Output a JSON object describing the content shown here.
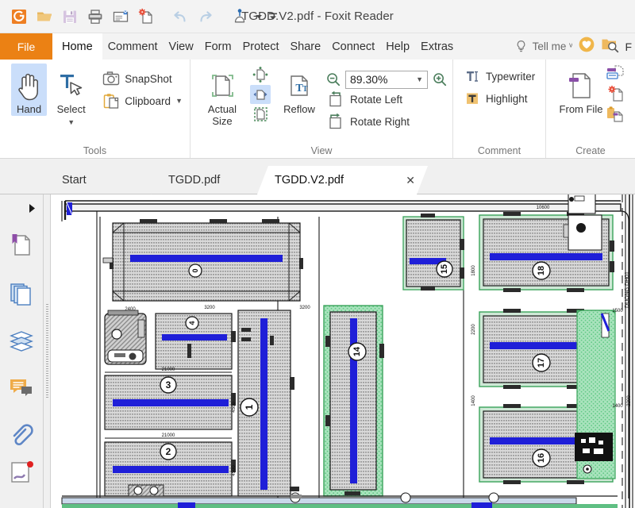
{
  "window": {
    "title": "TGDD.V2.pdf - Foxit Reader"
  },
  "quick_access": {
    "buttons": [
      {
        "name": "foxit-logo-icon",
        "label": "Foxit"
      },
      {
        "name": "open-icon",
        "label": "Open"
      },
      {
        "name": "save-icon",
        "label": "Save"
      },
      {
        "name": "print-icon",
        "label": "Print"
      },
      {
        "name": "email-icon",
        "label": "Email"
      },
      {
        "name": "new-document-icon",
        "label": "Create PDF"
      },
      {
        "name": "undo-icon",
        "label": "Undo"
      },
      {
        "name": "redo-icon",
        "label": "Redo"
      },
      {
        "name": "customize-icon",
        "label": "Customize"
      },
      {
        "name": "customize-dropdown-icon",
        "label": "More"
      },
      {
        "name": "minimize-ribbon-icon",
        "label": "Minimize"
      }
    ]
  },
  "ribbon": {
    "file_tab": "File",
    "tabs": [
      {
        "label": "Home",
        "active": true
      },
      {
        "label": "Comment",
        "active": false
      },
      {
        "label": "View",
        "active": false
      },
      {
        "label": "Form",
        "active": false
      },
      {
        "label": "Protect",
        "active": false
      },
      {
        "label": "Share",
        "active": false
      },
      {
        "label": "Connect",
        "active": false
      },
      {
        "label": "Help",
        "active": false
      },
      {
        "label": "Extras",
        "active": false
      }
    ],
    "tell_me": "Tell me ᵛ",
    "groups": {
      "tools": {
        "label": "Tools",
        "hand": "Hand",
        "select": "Select",
        "snapshot": "SnapShot",
        "clipboard": "Clipboard"
      },
      "view": {
        "label": "View",
        "actual_size": "Actual Size",
        "reflow": "Reflow",
        "zoom_value": "89.30%",
        "rotate_left": "Rotate Left",
        "rotate_right": "Rotate Right"
      },
      "comment": {
        "label": "Comment",
        "typewriter": "Typewriter",
        "highlight": "Highlight"
      },
      "create": {
        "label": "Create",
        "from_file": "From File"
      }
    }
  },
  "doc_tabs": [
    {
      "label": "Start",
      "active": false,
      "closable": false
    },
    {
      "label": "TGDD.pdf",
      "active": false,
      "closable": false
    },
    {
      "label": "TGDD.V2.pdf",
      "active": true,
      "closable": true,
      "close": "✕"
    }
  ],
  "sidebar": {
    "expand_arrow": "▶",
    "items": [
      {
        "name": "bookmarks-panel-icon",
        "label": "Bookmarks"
      },
      {
        "name": "pages-panel-icon",
        "label": "Page Thumbnails"
      },
      {
        "name": "layers-panel-icon",
        "label": "Layers"
      },
      {
        "name": "comments-panel-icon",
        "label": "Comments"
      },
      {
        "name": "attachments-panel-icon",
        "label": "Attachments"
      },
      {
        "name": "signatures-panel-icon",
        "label": "Digital Signatures"
      }
    ]
  },
  "document": {
    "kind": "site-plan-drawing",
    "building_markers": [
      "1",
      "2",
      "3",
      "14",
      "15",
      "16",
      "17",
      "18"
    ],
    "dimension_labels": [
      "10600",
      "2200",
      "1800",
      "1400",
      "1500",
      "21000",
      "4500"
    ]
  },
  "colors": {
    "accent": "#eb8114",
    "titlebar": "#f3f3f3",
    "ribbon_bg": "#ffffff",
    "selection": "#cadefa",
    "plan_blue": "#1f1fd8",
    "plan_green": "#3aa35a",
    "hatch_gray": "#d2d2d2"
  }
}
